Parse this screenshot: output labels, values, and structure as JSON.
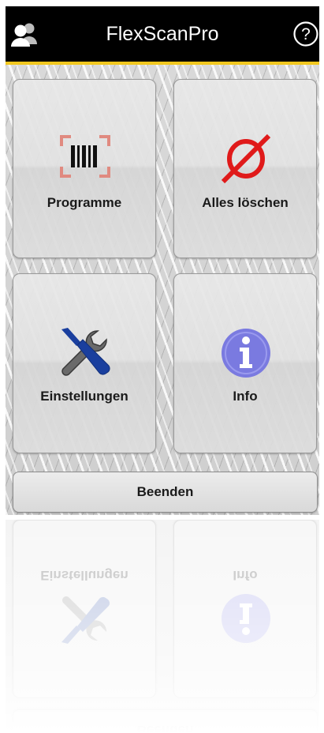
{
  "app": {
    "title": "FlexScanPro"
  },
  "header": {
    "user_icon": "user-group-icon",
    "help_icon": "help-circle-icon"
  },
  "tiles": [
    {
      "label": "Programme",
      "icon": "barcode-scan-icon",
      "accent": "#e08a80"
    },
    {
      "label": "Alles löschen",
      "icon": "delete-all-icon",
      "accent": "#e01a1a"
    },
    {
      "label": "Einstellungen",
      "icon": "tools-icon",
      "accent": "#1a3f9e"
    },
    {
      "label": "Info",
      "icon": "info-icon",
      "accent": "#7a7ae0"
    }
  ],
  "exit_button": {
    "label": "Beenden"
  },
  "colors": {
    "header": "#000000",
    "accent_bar": "#f2c81f"
  }
}
